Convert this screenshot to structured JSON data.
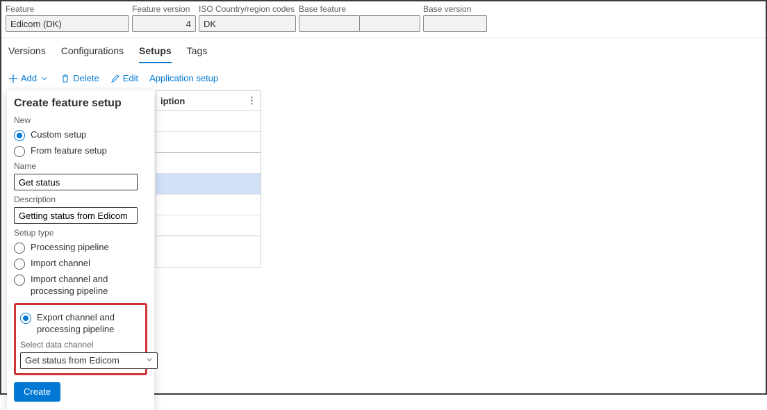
{
  "header": {
    "feature_label": "Feature",
    "feature_value": "Edicom (DK)",
    "version_label": "Feature version",
    "version_value": "4",
    "iso_label": "ISO Country/region codes",
    "iso_value": "DK",
    "base_label": "Base feature",
    "base_value1": "",
    "base_value2": "",
    "base_version_label": "Base version",
    "base_version_value": ""
  },
  "tabs": {
    "versions": "Versions",
    "configurations": "Configurations",
    "setups": "Setups",
    "tags": "Tags"
  },
  "toolbar": {
    "add": "Add",
    "delete": "Delete",
    "edit": "Edit",
    "app_setup": "Application setup"
  },
  "flyout": {
    "title": "Create feature setup",
    "new_label": "New",
    "radio_custom": "Custom setup",
    "radio_from": "From feature setup",
    "name_label": "Name",
    "name_value": "Get status",
    "description_label": "Description",
    "description_value": "Getting status from Edicom",
    "setup_type_label": "Setup type",
    "radio_processing": "Processing pipeline",
    "radio_import": "Import channel",
    "radio_import_proc": "Import channel and processing pipeline",
    "radio_export_proc": "Export channel and processing pipeline",
    "select_channel_label": "Select data channel",
    "select_channel_value": "Get status from Edicom",
    "create_btn": "Create"
  },
  "grid": {
    "header": "iption"
  }
}
